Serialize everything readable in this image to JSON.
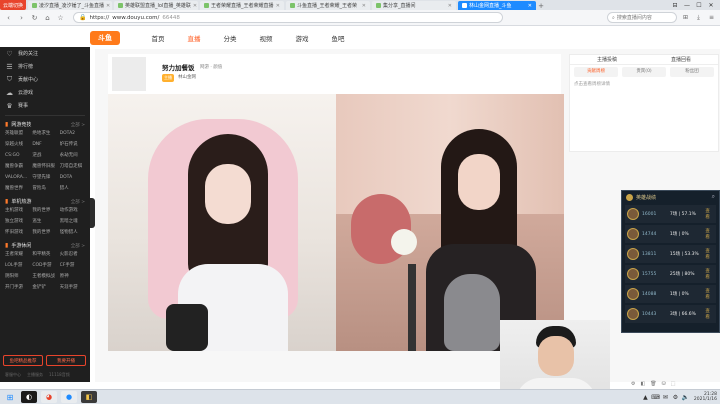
{
  "browser": {
    "logo_text": "云端切换",
    "tabs": [
      {
        "label": "凌汐直播_凌汐锤了_斗鱼直播",
        "active": false
      },
      {
        "label": "英雄联盟直播_lol直播_英雄联",
        "active": false
      },
      {
        "label": "王者荣耀直播_王者荣耀直播",
        "active": false
      },
      {
        "label": "斗鱼直播_王者荣耀_王者荣",
        "active": false
      },
      {
        "label": "集分享_直播间",
        "active": false
      },
      {
        "label": "林山金网直播_斗鱼",
        "active": true
      }
    ],
    "newtab": "+",
    "url_scheme": "https://",
    "url_host": "www.douyu.com/",
    "url_path": "66448",
    "search_placeholder": "搜索直播间内容",
    "window_controls": [
      "⊟",
      "—",
      "☐",
      "✕"
    ]
  },
  "site": {
    "logo": "斗鱼",
    "nav": [
      {
        "label": "首页",
        "active": false
      },
      {
        "label": "直播",
        "active": true
      },
      {
        "label": "分类",
        "active": false
      },
      {
        "label": "视频",
        "active": false
      },
      {
        "label": "游戏",
        "active": false
      },
      {
        "label": "鱼吧",
        "active": false
      }
    ]
  },
  "sidebar": {
    "top_items": [
      {
        "icon": "heart-icon",
        "glyph": "♡",
        "label": "我的关注"
      },
      {
        "icon": "rank-icon",
        "glyph": "☰",
        "label": "排行榜"
      },
      {
        "icon": "shield-icon",
        "glyph": "⛉",
        "label": "贡献中心"
      },
      {
        "icon": "cloud-icon",
        "glyph": "☁",
        "label": "云游戏"
      },
      {
        "icon": "crown-icon",
        "glyph": "♛",
        "label": "赛事"
      }
    ],
    "sections": [
      {
        "title": "网游竞技",
        "more": "全部 >",
        "items": [
          "英雄联盟",
          "绝地求生",
          "DOTA2",
          "穿越火线",
          "DNF",
          "炉石传说",
          "CS:GO",
          "逆战",
          "永劫无间",
          "魔兽争霸",
          "魔兽怀旧服",
          "刀塔自走棋",
          "VALORA…",
          "守望先锋",
          "DOTA",
          "魔兽世界",
          "冒险岛",
          "猎人"
        ]
      },
      {
        "title": "单机热游",
        "more": "全部 >",
        "items": [
          "主机游戏",
          "我的世界",
          "动作游戏",
          "独立游戏",
          "逃生",
          "黑暗之魂",
          "怀旧游戏",
          "我的世界",
          "怪物猎人"
        ]
      },
      {
        "title": "手游休闲",
        "more": "全部 >",
        "items": [
          "王者荣耀",
          "和平精英",
          "火影忍者",
          "LOL手游",
          "COD手游",
          "CF手游",
          "阴阳师",
          "王者模拟战",
          "原神",
          "开门手游",
          "金铲铲",
          "天涯手游"
        ]
      }
    ],
    "btn_primary": "鱼吧精品推荐",
    "btn_secondary": "我要开播",
    "footer": [
      "客服中心",
      "主播服务",
      "11118音频"
    ]
  },
  "room": {
    "title": "努力加餐饭",
    "category": "网游 · 颜值",
    "badge": "主播",
    "owner": "林山金网"
  },
  "sidepanel": {
    "tabs": [
      "主播投稿",
      "直播回看"
    ],
    "subtabs": [
      {
        "label": "贡献周榜",
        "active": true
      },
      {
        "label": "贵宾(0)",
        "active": false
      },
      {
        "label": "粉丝团",
        "active": false
      }
    ],
    "note": "点击查看周榜详情"
  },
  "overlay": {
    "title": "英雄战绩",
    "rows": [
      {
        "score": "16001",
        "record": "7场 | 57.1%",
        "go": "查看"
      },
      {
        "score": "14744",
        "record": "1场 | 0%",
        "go": "查看"
      },
      {
        "score": "13811",
        "record": "15场 | 53.3%",
        "go": "查看"
      },
      {
        "score": "15755",
        "record": "25场 | 80%",
        "go": "查看"
      },
      {
        "score": "14088",
        "record": "1场 | 0%",
        "go": "查看"
      },
      {
        "score": "10443",
        "record": "3场 | 66.6%",
        "go": "查看"
      }
    ]
  },
  "mini_toolbar": [
    "⚙",
    "◧",
    "🗑",
    "⛁",
    "⬚"
  ],
  "taskbar": {
    "apps": [
      "◐",
      "◕",
      "●",
      "◧"
    ],
    "tray": [
      "▲",
      "⌨",
      "✉",
      "⚙",
      "🔈"
    ],
    "time": "21:28",
    "date": "2021/1/16"
  }
}
